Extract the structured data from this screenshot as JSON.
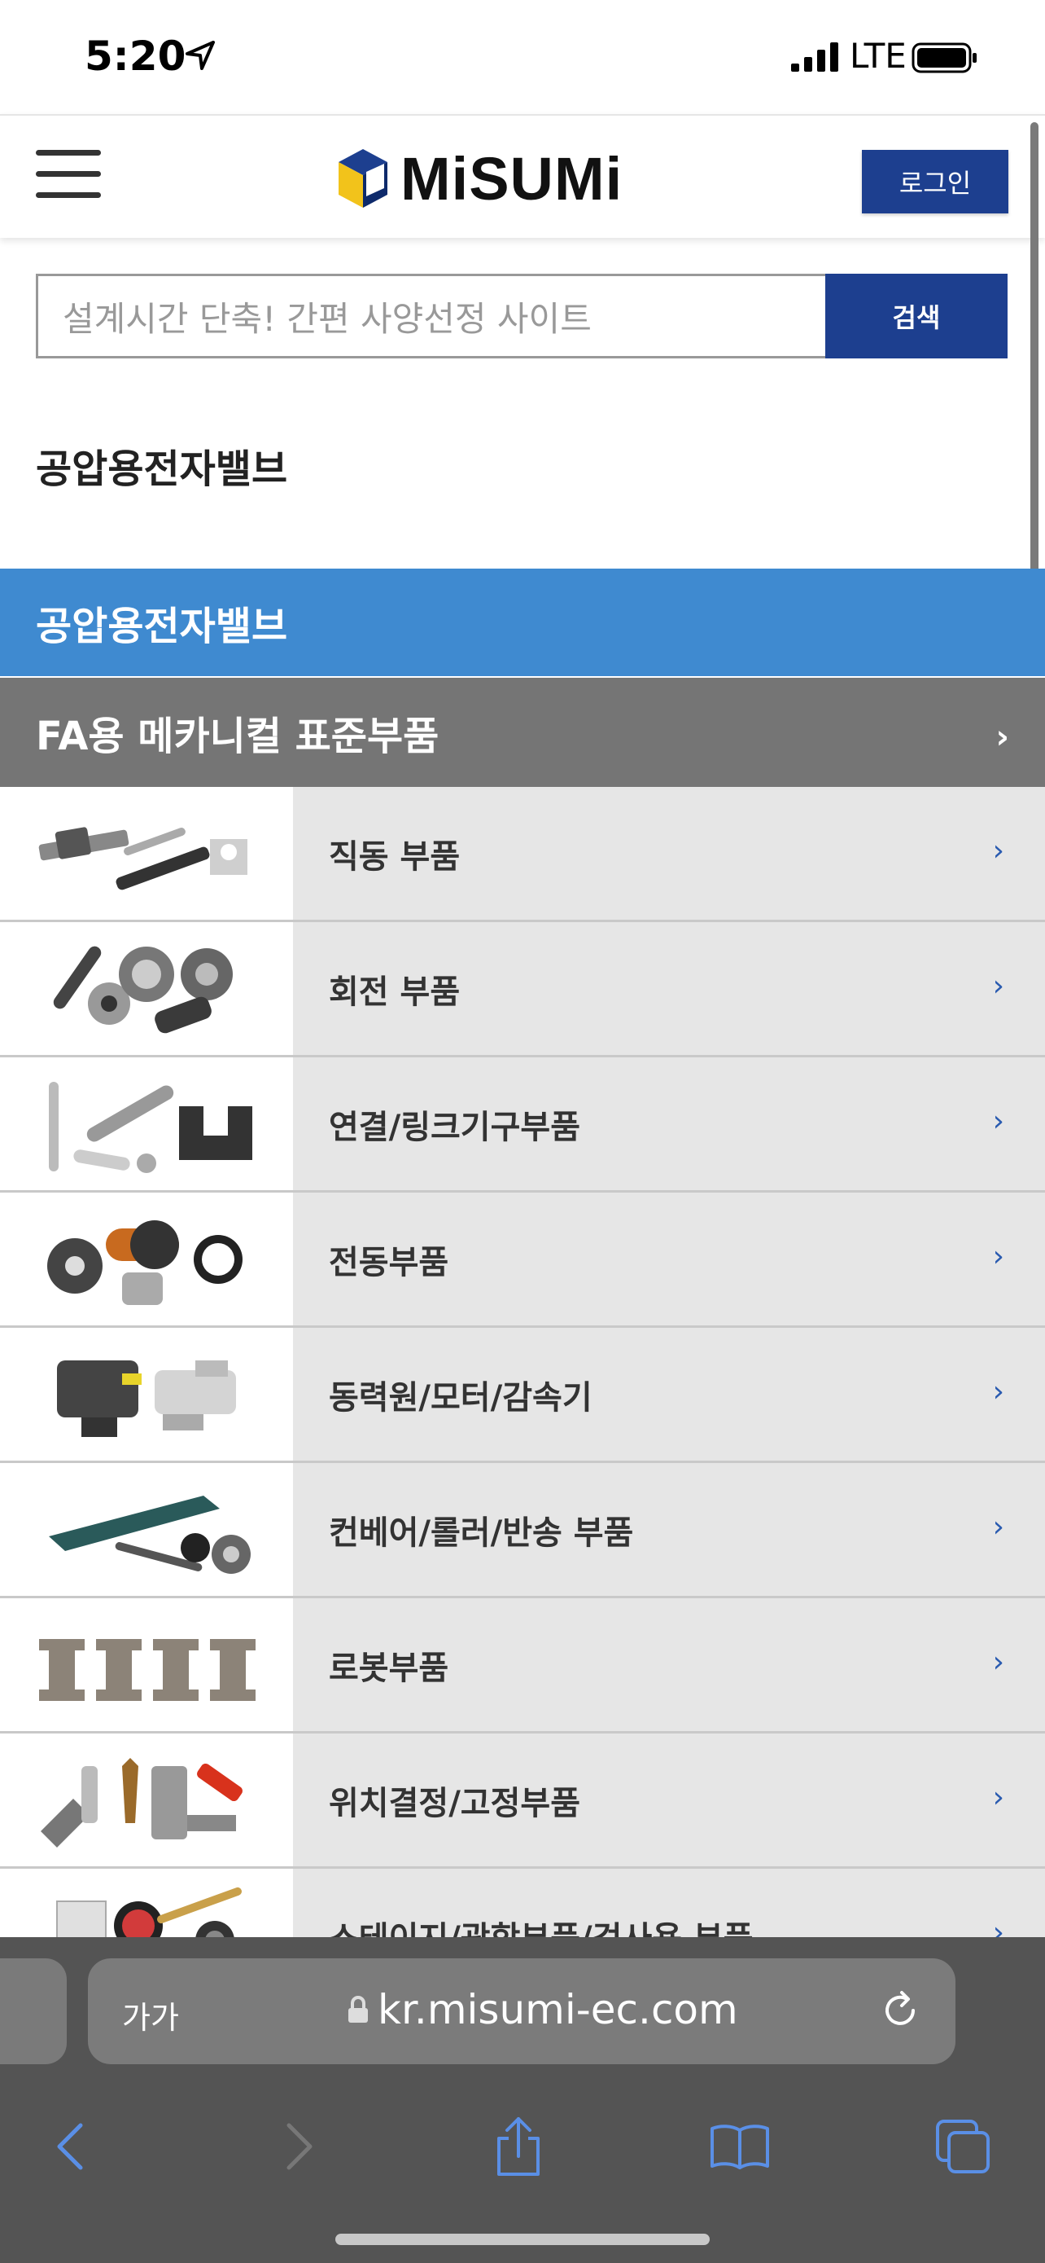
{
  "status_bar": {
    "time": "5:20",
    "network": "LTE"
  },
  "header": {
    "logo_text": "MiSUMi",
    "login_label": "로그인"
  },
  "search": {
    "placeholder": "설계시간 단축! 간편 사양선정 사이트",
    "button_label": "검색"
  },
  "page_title": "공압용전자밸브",
  "category_banner": "공압용전자밸브",
  "section": {
    "label": "FA용 메카니컬 표준부품"
  },
  "items": [
    {
      "label": "직동 부품"
    },
    {
      "label": "회전 부품"
    },
    {
      "label": "연결/링크기구부품"
    },
    {
      "label": "전동부품"
    },
    {
      "label": "동력원/모터/감속기"
    },
    {
      "label": "컨베어/롤러/반송 부품"
    },
    {
      "label": "로봇부품"
    },
    {
      "label": "위치결정/고정부품"
    },
    {
      "label": "스테이지/광학부품/검사용 부품"
    }
  ],
  "browser": {
    "text_size_label": "가가",
    "url": "kr.misumi-ec.com"
  },
  "colors": {
    "brand_blue": "#1d3f8f",
    "banner_blue": "#3f8ad0",
    "section_gray": "#757575",
    "accent_blue": "#2a5bb0"
  }
}
